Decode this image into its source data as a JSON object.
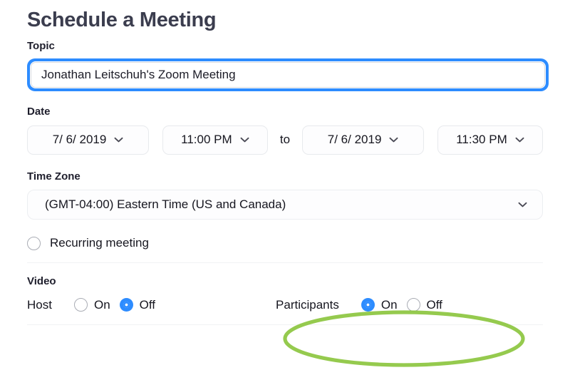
{
  "heading": "Schedule a Meeting",
  "topic": {
    "label": "Topic",
    "value": "Jonathan Leitschuh's Zoom Meeting",
    "placeholder": "Topic"
  },
  "date": {
    "label": "Date",
    "start_date": "7/  6/ 2019",
    "start_time": "11:00 PM",
    "separator": "to",
    "end_date": "7/  6/ 2019",
    "end_time": "11:30 PM"
  },
  "timezone": {
    "label": "Time Zone",
    "value": "(GMT-04:00) Eastern Time (US and Canada)"
  },
  "recurring": {
    "label": "Recurring meeting",
    "checked": false
  },
  "video": {
    "label": "Video",
    "host": {
      "label": "Host",
      "on_label": "On",
      "off_label": "Off",
      "selected": "Off"
    },
    "participants": {
      "label": "Participants",
      "on_label": "On",
      "off_label": "Off",
      "selected": "On"
    }
  },
  "colors": {
    "accent_blue": "#2d8cff",
    "annotation_green": "#8cc63f",
    "heading": "#3b3d4e",
    "divider": "#f1f2f4"
  }
}
